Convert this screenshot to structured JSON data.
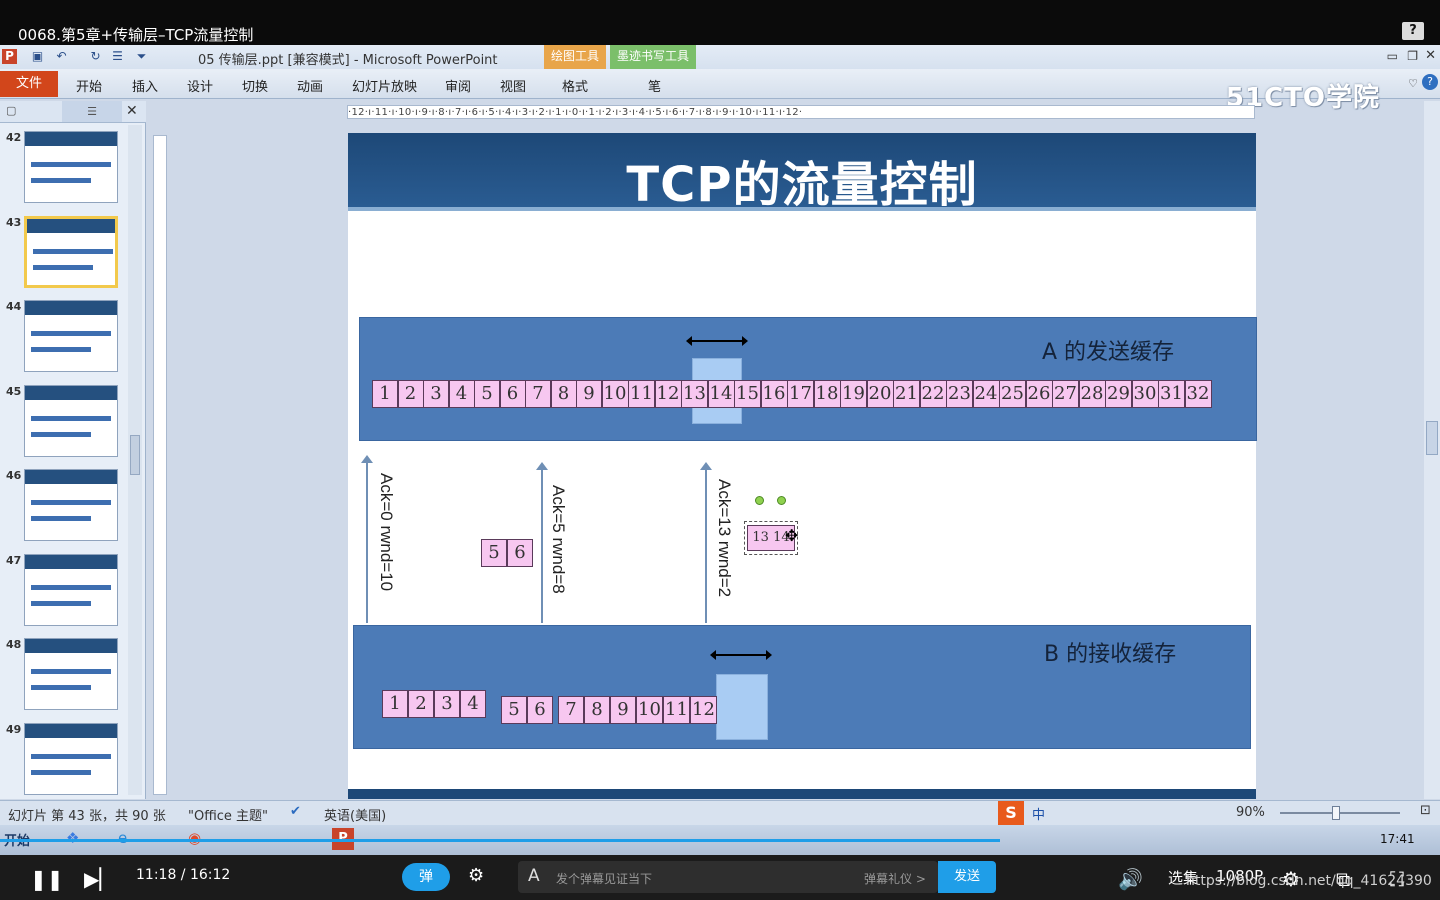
{
  "window_title": "0068.第5章+传输层–TCP流量控制",
  "ppt": {
    "doc_title": "05 传输层.ppt [兼容模式] - Microsoft PowerPoint",
    "context_tabs": [
      "绘图工具",
      "墨迹书写工具"
    ],
    "file_tab": "文件",
    "ribbon_tabs": [
      "开始",
      "插入",
      "设计",
      "切换",
      "动画",
      "幻灯片放映",
      "审阅",
      "视图",
      "格式",
      "笔"
    ],
    "logo": "51CTO学院",
    "thumbnails": [
      {
        "num": "42"
      },
      {
        "num": "43",
        "selected": true
      },
      {
        "num": "44"
      },
      {
        "num": "45"
      },
      {
        "num": "46"
      },
      {
        "num": "47"
      },
      {
        "num": "48"
      },
      {
        "num": "49"
      }
    ],
    "ruler": "·12·ı·11·ı·10·ı·9·ı·8·ı·7·ı·6·ı·5·ı·4·ı·3·ı·2·ı·1·ı·0·ı·1·ı·2·ı·3·ı·4·ı·5·ı·6·ı·7·ı·8·ı·9·ı·10·ı·11·ı·12·"
  },
  "slide": {
    "title": "TCP的流量控制",
    "a_label": "A 的发送缓存",
    "b_label": "B 的接收缓存",
    "a_cells": [
      "1",
      "2",
      "3",
      "4",
      "5",
      "6",
      "7",
      "8",
      "9",
      "10",
      "11",
      "12",
      "13",
      "14",
      "15",
      "16",
      "17",
      "18",
      "19",
      "20",
      "21",
      "22",
      "23",
      "24",
      "25",
      "26",
      "27",
      "28",
      "29",
      "30",
      "31",
      "32"
    ],
    "b_cells_group1": [
      "1",
      "2",
      "3",
      "4"
    ],
    "b_cells_group2": [
      "5",
      "6",
      "7",
      "8",
      "9",
      "10",
      "11",
      "12"
    ],
    "middle_cells": [
      "5",
      "6"
    ],
    "selected_shape_text": "13 14",
    "ack1": "Ack=0  rwnd=10",
    "ack2": "Ack=5  rwnd=8",
    "ack3": "Ack=13  rwnd=2"
  },
  "status": {
    "slide_info": "幻灯片 第 43 张，共 90 张",
    "theme": "\"Office 主题\"",
    "language": "英语(美国)",
    "zoom": "90%"
  },
  "taskbar": {
    "start": "开始",
    "time": "17:41"
  },
  "player": {
    "time": "11:18 / 16:12",
    "danmu_button": "弹",
    "danmu_placeholder": "发个弹幕见证当下",
    "danmu_etiquette": "弹幕礼仪 >",
    "send": "发送",
    "select": "选集",
    "quality": "1080P",
    "watermark": "https://blog.csdn.net/qq_41624390"
  }
}
